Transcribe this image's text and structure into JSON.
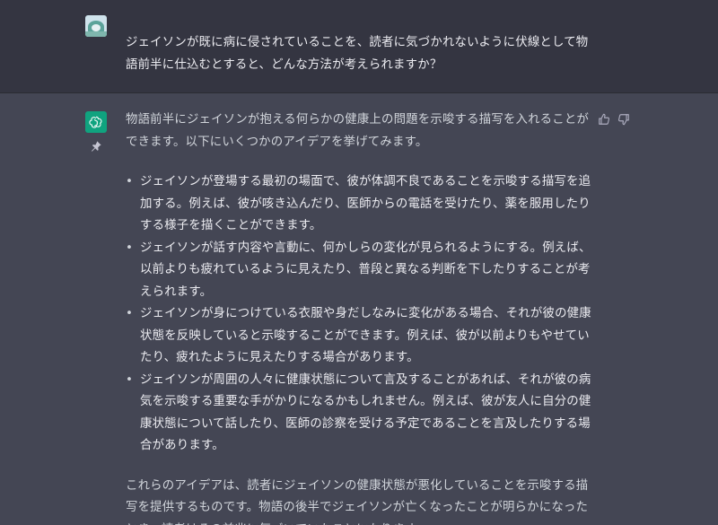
{
  "user_message": {
    "text": "ジェイソンが既に病に侵されていることを、読者に気づかれないように伏線として物語前半に仕込むとすると、どんな方法が考えられますか？"
  },
  "assistant_message": {
    "intro": "物語前半にジェイソンが抱える何らかの健康上の問題を示唆する描写を入れることができます。以下にいくつかのアイデアを挙げてみます。",
    "bullets": [
      "ジェイソンが登場する最初の場面で、彼が体調不良であることを示唆する描写を追加する。例えば、彼が咳き込んだり、医師からの電話を受けたり、薬を服用したりする様子を描くことができます。",
      "ジェイソンが話す内容や言動に、何かしらの変化が見られるようにする。例えば、以前よりも疲れているように見えたり、普段と異なる判断を下したりすることが考えられます。",
      "ジェイソンが身につけている衣服や身だしなみに変化がある場合、それが彼の健康状態を反映していると示唆することができます。例えば、彼が以前よりもやせていたり、疲れたように見えたりする場合があります。",
      "ジェイソンが周囲の人々に健康状態について言及することがあれば、それが彼の病気を示唆する重要な手がかりになるかもしれません。例えば、彼が友人に自分の健康状態について話したり、医師の診察を受ける予定であることを言及したりする場合があります。"
    ],
    "conclusion": "これらのアイデアは、読者にジェイソンの健康状態が悪化していることを示唆する描写を提供するものです。物語の後半でジェイソンが亡くなったことが明らかになったとき、読者はその前兆に気づいていたことになります。"
  },
  "icons": {
    "user_avatar": "user-avatar-image",
    "assistant_avatar": "openai-logo-icon",
    "pin": "pin-icon",
    "thumb_up": "thumbs-up-icon",
    "thumb_down": "thumbs-down-icon"
  },
  "colors": {
    "user_bg": "#343541",
    "assistant_bg": "#444654",
    "assistant_avatar_bg": "#10a37f",
    "text": "#ececf1"
  }
}
